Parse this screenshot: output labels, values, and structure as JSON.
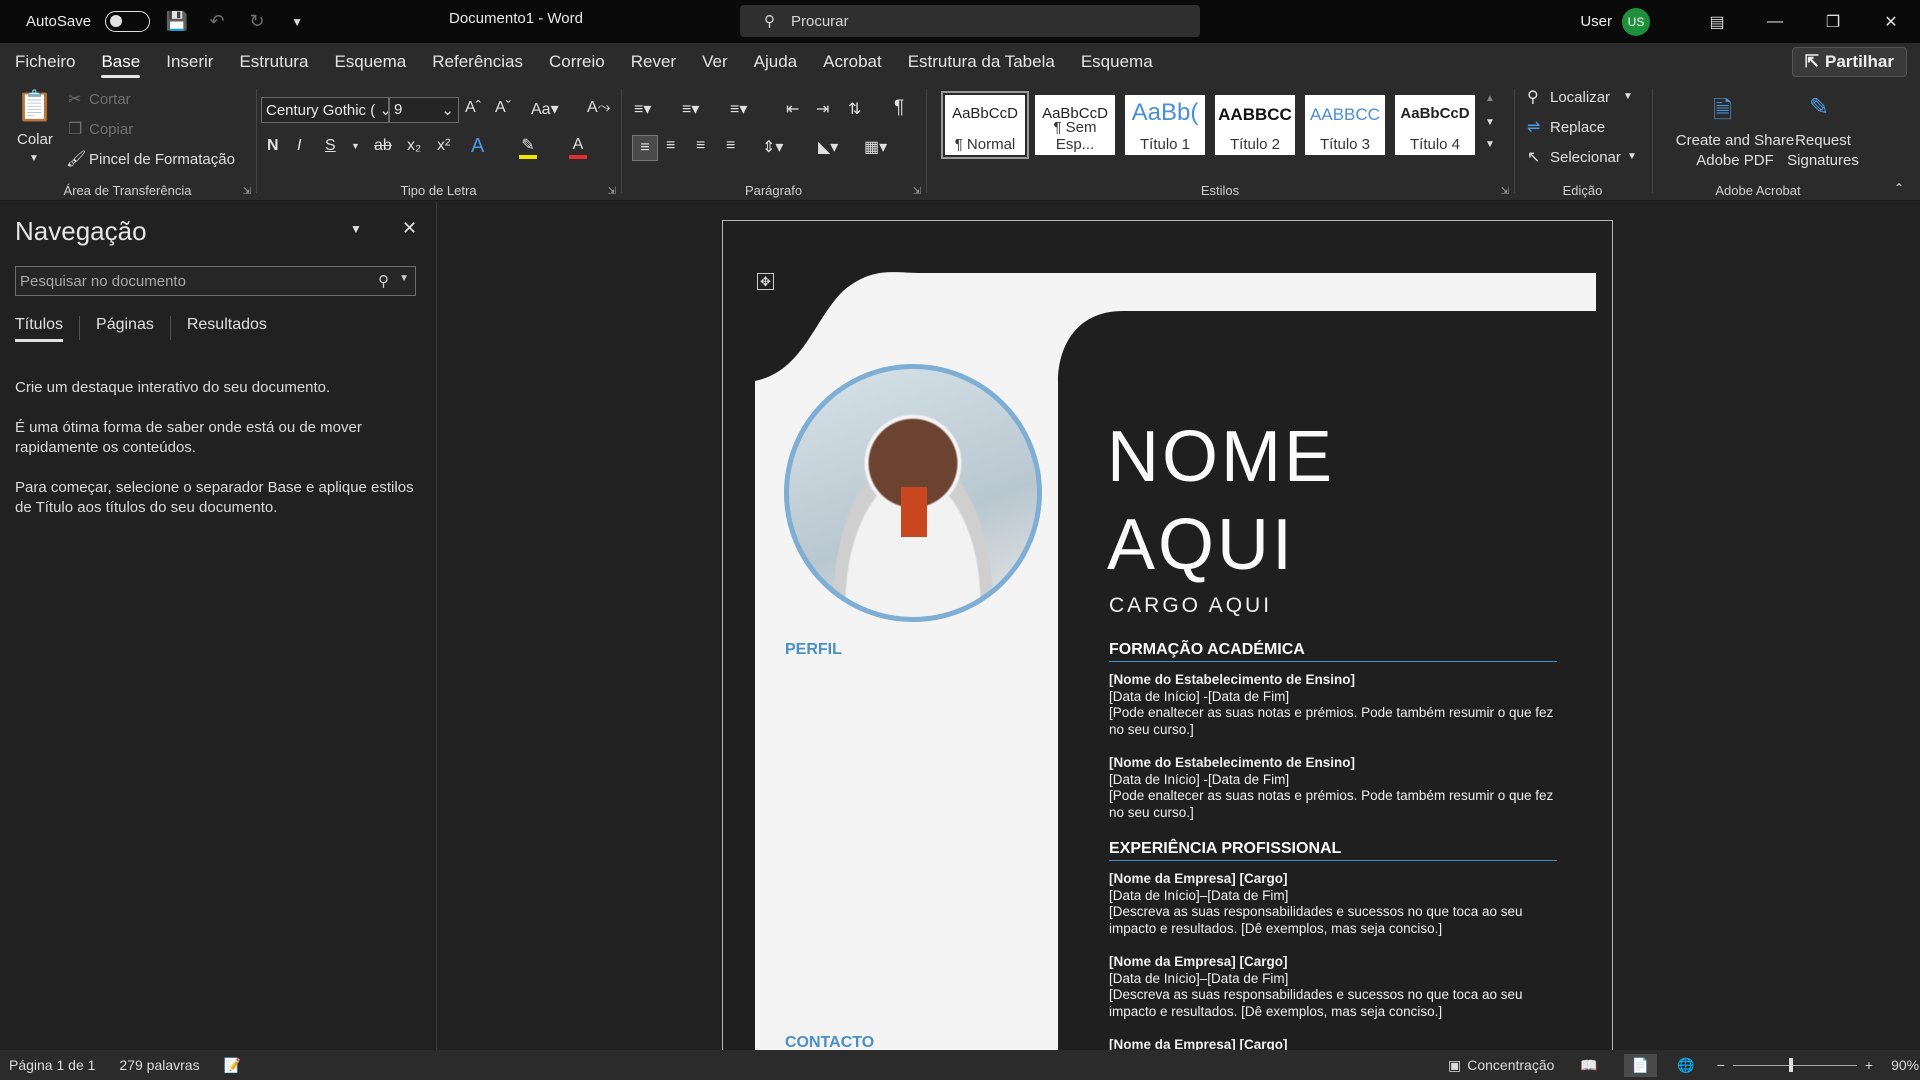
{
  "titlebar": {
    "autosave": "AutoSave",
    "doc_title": "Documento1  -  Word",
    "search_placeholder": "Procurar",
    "user": "User",
    "avatar": "US"
  },
  "menu": {
    "items": [
      "Ficheiro",
      "Base",
      "Inserir",
      "Estrutura",
      "Esquema",
      "Referências",
      "Correio",
      "Rever",
      "Ver",
      "Ajuda",
      "Acrobat",
      "Estrutura da Tabela",
      "Esquema"
    ],
    "share": "Partilhar"
  },
  "ribbon": {
    "clipboard": {
      "paste": "Colar",
      "cut": "Cortar",
      "copy": "Copiar",
      "format_painter": "Pincel de Formatação",
      "title": "Área de Transferência"
    },
    "font": {
      "name": "Century Gothic (",
      "size": "9",
      "title": "Tipo de Letra",
      "bold": "N",
      "italic": "I",
      "underline": "S"
    },
    "paragraph": {
      "title": "Parágrafo"
    },
    "styles": {
      "title": "Estilos",
      "tiles": [
        {
          "sample": "AaBbCcD",
          "name": "¶ Normal"
        },
        {
          "sample": "AaBbCcD",
          "name": "¶ Sem Esp..."
        },
        {
          "sample": "AaBb(",
          "name": "Título 1"
        },
        {
          "sample": "AABBCC",
          "name": "Título 2"
        },
        {
          "sample": "AABBCC",
          "name": "Título 3"
        },
        {
          "sample": "AaBbCcD",
          "name": "Título 4"
        }
      ]
    },
    "editing": {
      "find": "Localizar",
      "replace": "Replace",
      "select": "Selecionar",
      "title": "Edição"
    },
    "acrobat": {
      "create": "Create and Share",
      "create2": "Adobe PDF",
      "request": "Request",
      "request2": "Signatures",
      "title": "Adobe Acrobat"
    }
  },
  "nav": {
    "title": "Navegação",
    "search_placeholder": "Pesquisar no documento",
    "tabs": [
      "Títulos",
      "Páginas",
      "Resultados"
    ],
    "p1": "Crie um destaque interativo do seu documento.",
    "p2": "É uma ótima forma de saber onde está ou de mover rapidamente os conteúdos.",
    "p3": "Para começar, selecione o separador Base e aplique estilos de Título aos títulos do seu documento."
  },
  "resume": {
    "name1": "NOME",
    "name2": "AQUI",
    "job": "CARGO AQUI",
    "profile": "PERFIL",
    "contact": "CONTACTO",
    "edu_heading": "FORMAÇÃO ACADÉMICA",
    "edu": [
      {
        "title": "[Nome do Estabelecimento de Ensino]",
        "dates": "[Data de Início]  -[Data de Fim]",
        "desc": "[Pode enaltecer as suas notas e prémios. Pode também resumir o que fez no seu curso.]"
      },
      {
        "title": "[Nome do Estabelecimento de Ensino]",
        "dates": "[Data de Início]  -[Data de Fim]",
        "desc": "[Pode enaltecer as suas notas e prémios. Pode também resumir o que fez no seu curso.]"
      }
    ],
    "exp_heading": "EXPERIÊNCIA PROFISSIONAL",
    "exp": [
      {
        "title": "[Nome da Empresa]  [Cargo]",
        "dates": "[Data de Início]–[Data de Fim]",
        "desc": "[Descreva as suas responsabilidades e sucessos no que toca ao seu impacto e resultados. [Dê exemplos, mas seja conciso.]"
      },
      {
        "title": "[Nome da Empresa]  [Cargo]",
        "dates": "[Data de Início]–[Data de Fim]",
        "desc": "[Descreva as suas responsabilidades e sucessos no que toca ao seu impacto e resultados. [Dê exemplos, mas seja conciso.]"
      },
      {
        "title": "[Nome da Empresa]  [Cargo]"
      }
    ]
  },
  "status": {
    "page": "Página 1 de 1",
    "words": "279 palavras",
    "focus": "Concentração",
    "zoom": "90%"
  }
}
